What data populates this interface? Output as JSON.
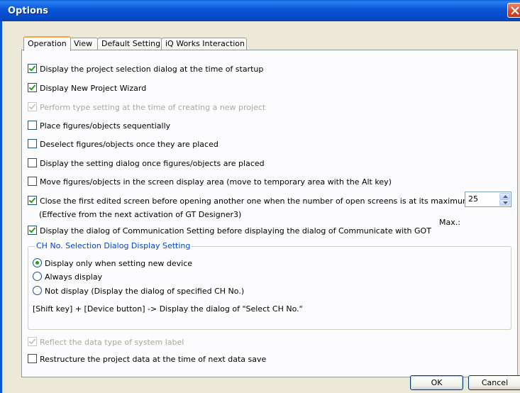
{
  "window": {
    "title": "Options"
  },
  "tabs": [
    {
      "label": "Operation",
      "active": true
    },
    {
      "label": "View",
      "active": false
    },
    {
      "label": "Default Setting",
      "active": false
    },
    {
      "label": "iQ Works Interaction",
      "active": false
    }
  ],
  "options": {
    "project_selection": {
      "label": "Display the project selection dialog at the time of startup",
      "checked": true
    },
    "new_project_wizard": {
      "label": "Display New Project Wizard",
      "checked": true
    },
    "type_setting": {
      "label": "Perform type setting at the time of creating a new project",
      "checked": true,
      "disabled": true
    },
    "place_sequentially": {
      "label": "Place figures/objects sequentially",
      "checked": false
    },
    "deselect": {
      "label": "Deselect figures/objects once they are placed",
      "checked": false
    },
    "setting_dialog": {
      "label": "Display the setting dialog once figures/objects are placed",
      "checked": false
    },
    "move_objects": {
      "label": "Move figures/objects in the screen display area (move to temporary area with the Alt key)",
      "checked": false
    },
    "close_first": {
      "label": "Close the first edited screen before opening another one when the number of open screens is at its maximum",
      "note": "(Effective from the next activation of GT Designer3)",
      "checked": true
    },
    "comm_setting": {
      "label": "Display the dialog of Communication Setting before displaying the dialog of Communicate with GOT",
      "checked": true
    },
    "reflect_type": {
      "label": "Reflect the data type of system label",
      "checked": true,
      "disabled": true
    },
    "restructure": {
      "label": "Restructure the project data at the time of next data save",
      "checked": false
    }
  },
  "max": {
    "label": "Max.:",
    "value": "25"
  },
  "ch_group": {
    "legend": "CH No. Selection Dialog Display Setting",
    "radios": [
      {
        "label": "Display only when setting new device",
        "checked": true
      },
      {
        "label": "Always display",
        "checked": false
      },
      {
        "label": "Not display (Display the dialog of specified CH No.)",
        "checked": false
      }
    ],
    "note": "[Shift key] + [Device button] -> Display the dialog of \"Select CH No.\""
  },
  "buttons": {
    "ok": "OK",
    "cancel": "Cancel"
  },
  "colors": {
    "title_bar": "#0855d6",
    "group_legend": "#0046d5",
    "check_mark": "#21a121",
    "active_tab_highlight": "#f5a54a"
  }
}
